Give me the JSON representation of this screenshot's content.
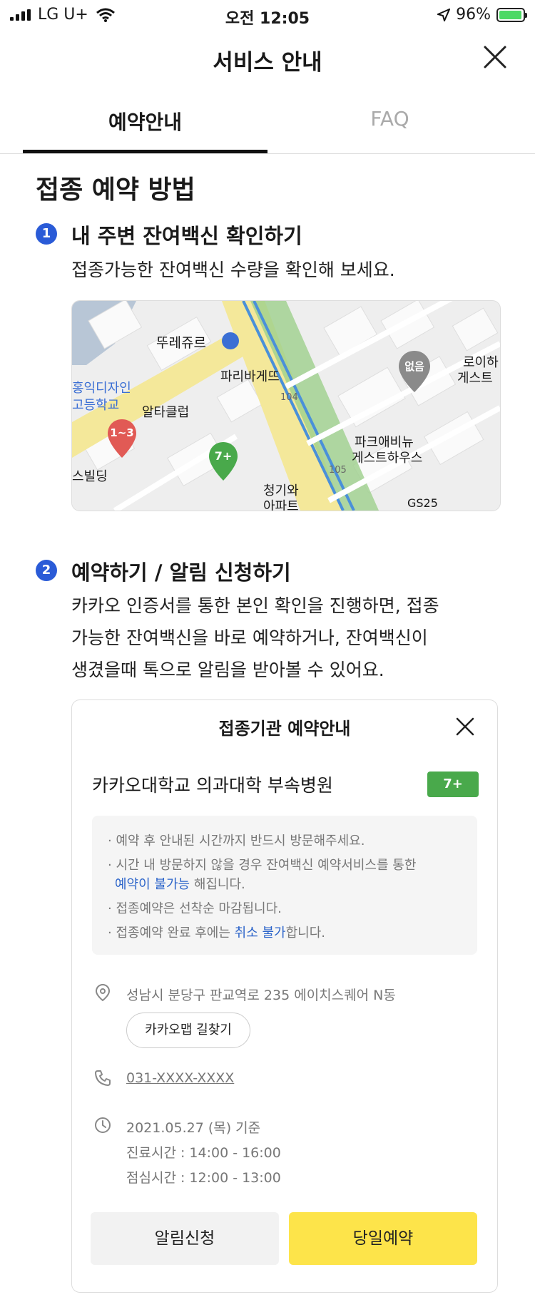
{
  "status_bar": {
    "carrier": "LG U+",
    "time": "오전 12:05",
    "battery": "96%"
  },
  "header": {
    "title": "서비스 안내"
  },
  "tabs": [
    {
      "label": "예약안내",
      "active": true
    },
    {
      "label": "FAQ",
      "active": false
    }
  ],
  "main": {
    "heading": "접종 예약 방법",
    "step1": {
      "number": "1",
      "title": "내 주변 잔여백신 확인하기",
      "desc": "접종가능한 잔여백신 수량을 확인해 보세요."
    },
    "map": {
      "labels": {
        "ttlj": "뚜레쥬르",
        "paris": "파리바게뜨",
        "hongik1": "홍익디자인",
        "hongik2": "고등학교",
        "alta": "알타클럽",
        "building": "스빌딩",
        "park1": "파크애비뉴",
        "park2": "게스트하우스",
        "roi1": "로이하",
        "roi2": "게스트",
        "chung1": "청기와",
        "chung2": "아파트",
        "gs": "GS25",
        "road104": "104",
        "road105": "105"
      },
      "pins": {
        "red": "1~3",
        "green": "7+",
        "gray": "없음"
      }
    },
    "step2": {
      "number": "2",
      "title": "예약하기 / 알림 신청하기",
      "desc": [
        "카카오 인증서를 통한 본인 확인을 진행하면, 접종",
        "가능한 잔여백신을 바로 예약하거나, 잔여백신이",
        "생겼을때 톡으로 알림을 받아볼 수 있어요."
      ]
    },
    "card": {
      "title": "접종기관 예약안내",
      "hospital": "카카오대학교 의과대학 부속병원",
      "badge": "7+",
      "notices": {
        "n1": "· 예약 후 안내된 시간까지 반드시 방문해주세요.",
        "n2a": "· 시간 내 방문하지 않을 경우 잔여백신 예약서비스를 통한",
        "n2b_hl": "예약이 불가능",
        "n2b_rest": " 해집니다.",
        "n3": "· 접종예약은 선착순 마감됩니다.",
        "n4a": "· 접종예약 완료 후에는 ",
        "n4_hl": "취소 불가",
        "n4b": "합니다."
      },
      "address": "성남시 분당구 판교역로 235 에이치스퀘어 N동",
      "route_button": "카카오맵 길찾기",
      "phone": "031-XXXX-XXXX",
      "date": "2021.05.27 (목) 기준",
      "hours": "진료시간 : 14:00 - 16:00",
      "lunch": "점심시간 : 12:00 - 13:00",
      "notify_button": "알림신청",
      "reserve_button": "당일예약"
    }
  },
  "colors": {
    "accent_blue": "#2a5bd7",
    "badge_green": "#49a94b",
    "reserve_yellow": "#fde44a"
  }
}
